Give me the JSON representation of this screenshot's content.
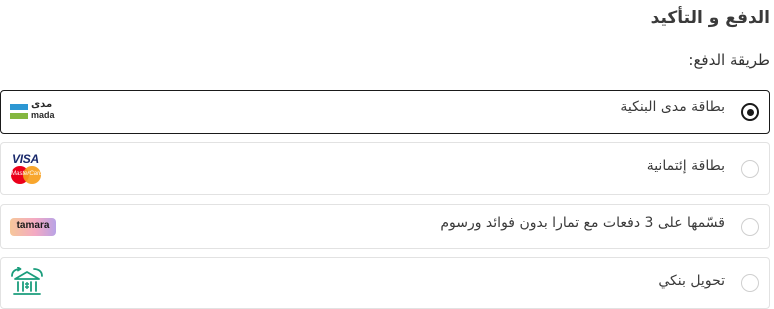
{
  "checkout": {
    "title": "الدفع و التأكيد",
    "payment_method_heading": "طريقة الدفع:"
  },
  "payment_options": [
    {
      "label": "بطاقة مدى البنكية",
      "selected": true,
      "logo": {
        "icon": "mada-logo",
        "text_ar": "مدى",
        "text_en": "mada"
      }
    },
    {
      "label": "بطاقة إئتمانية",
      "selected": false,
      "logo": {
        "icon": "visa-mastercard-logo",
        "visa_text": "VISA",
        "mastercard_text": "MasterCard"
      }
    },
    {
      "label": "قسّمها على 3 دفعات مع تمارا بدون فوائد ورسوم",
      "selected": false,
      "logo": {
        "icon": "tamara-logo",
        "text": "tamara"
      }
    },
    {
      "label": "تحويل بنكي",
      "selected": false,
      "logo": {
        "icon": "bank-transfer-icon"
      }
    }
  ],
  "colors": {
    "selected_border": "#1a1a1a",
    "option_border": "#e2e2e2",
    "mada_blue": "#2c97d3",
    "mada_green": "#84b740",
    "visa_blue": "#1a2a6c",
    "bank_icon_green": "#1a9d7c"
  }
}
